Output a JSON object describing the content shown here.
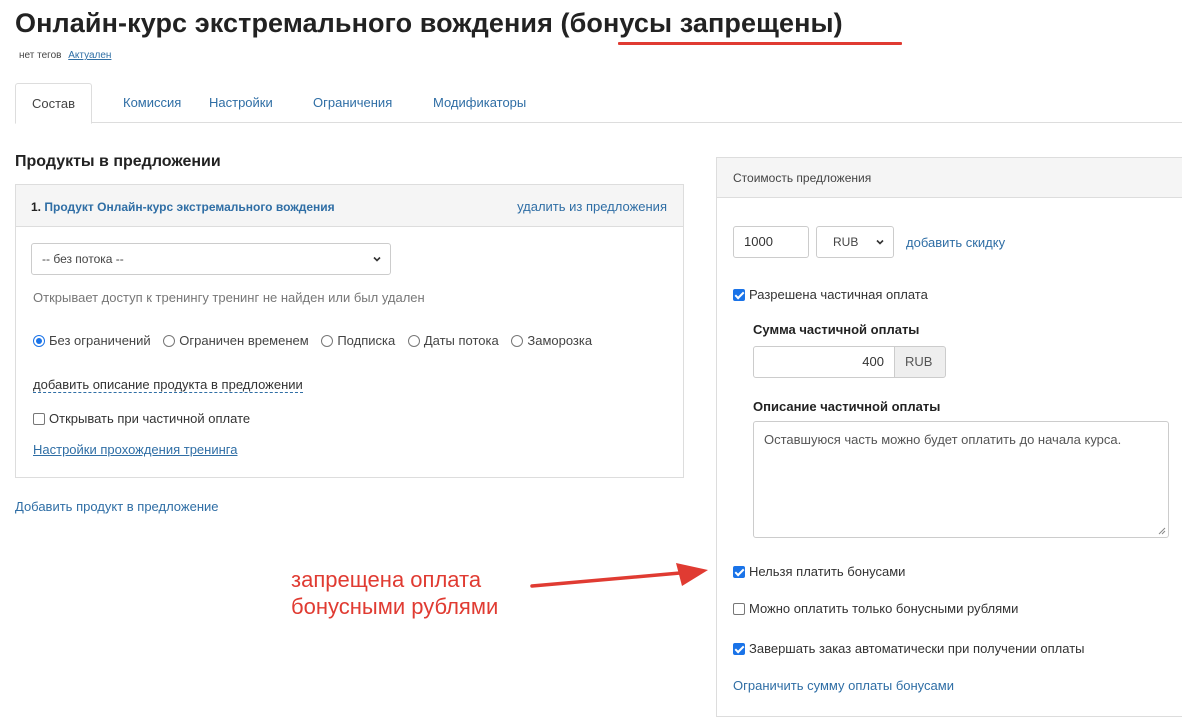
{
  "header": {
    "title": "Онлайн-курс экстремального вождения (бонусы запрещены)",
    "tags_label": "нет тегов",
    "status_link": "Актуален"
  },
  "tabs": [
    {
      "label": "Состав",
      "active": true
    },
    {
      "label": "Комиссия",
      "active": false
    },
    {
      "label": "Настройки",
      "active": false
    },
    {
      "label": "Ограничения",
      "active": false
    },
    {
      "label": "Модификаторы",
      "active": false
    }
  ],
  "products": {
    "section_title": "Продукты в предложении",
    "item": {
      "number": "1.",
      "product_link": "Продукт Онлайн-курс экстремального вождения",
      "remove_link": "удалить из предложения",
      "stream_select": "-- без потока --",
      "access_text": "Открывает доступ к тренингу тренинг не найден или был удален",
      "access_options": [
        {
          "label": "Без ограничений",
          "checked": true
        },
        {
          "label": "Ограничен временем",
          "checked": false
        },
        {
          "label": "Подписка",
          "checked": false
        },
        {
          "label": "Даты потока",
          "checked": false
        },
        {
          "label": "Заморозка",
          "checked": false
        }
      ],
      "add_description_link": "добавить описание продукта в предложении",
      "open_on_partial": {
        "label": "Открывать при частичной оплате",
        "checked": false
      },
      "training_settings_link": "Настройки прохождения тренинга"
    },
    "add_product_link": "Добавить продукт в предложение"
  },
  "cost": {
    "panel_title": "Стоимость предложения",
    "price_value": "1000",
    "currency": "RUB",
    "add_discount_link": "добавить скидку",
    "partial_allowed": {
      "label": "Разрешена частичная оплата",
      "checked": true
    },
    "partial_amount_label": "Сумма частичной оплаты",
    "partial_amount_value": "400",
    "partial_amount_currency": "RUB",
    "partial_description_label": "Описание частичной оплаты",
    "partial_description_value": "Оставшуюся часть можно будет оплатить до начала курса.",
    "no_bonus": {
      "label": "Нельзя платить бонусами",
      "checked": true
    },
    "bonus_only": {
      "label": "Можно оплатить только бонусными рублями",
      "checked": false
    },
    "auto_complete": {
      "label": "Завершать заказ автоматически при получении оплаты",
      "checked": true
    },
    "limit_bonus_link": "Ограничить сумму оплаты бонусами"
  },
  "annotation": {
    "line1": "запрещена оплата",
    "line2": "бонусными рублями"
  },
  "colors": {
    "accent": "#2f6ea5",
    "checkbox": "#1a73e8",
    "annotation": "#e03b32"
  }
}
